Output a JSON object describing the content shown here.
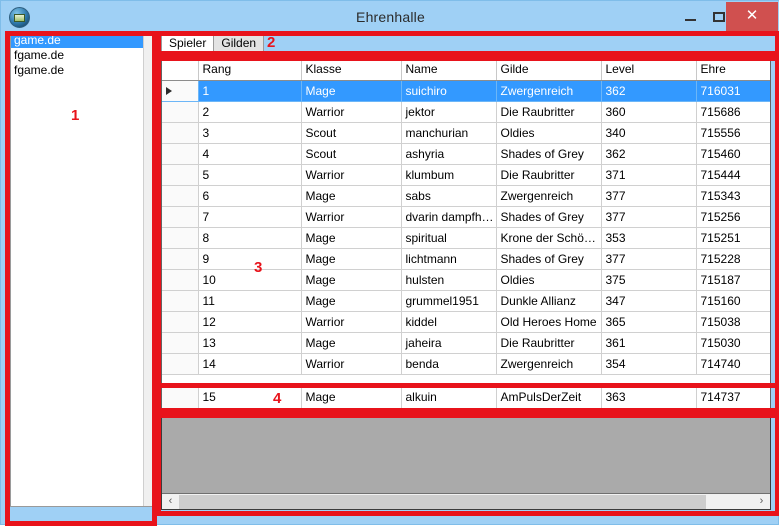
{
  "window": {
    "title": "Ehrenhalle",
    "icon": "app-globe-icon",
    "controls": {
      "minimize": "–",
      "maximize": "☐",
      "close": "✕"
    }
  },
  "sidebar": {
    "items": [
      {
        "label": "game.de",
        "selected": true
      },
      {
        "label": "fgame.de",
        "selected": false
      },
      {
        "label": "fgame.de",
        "selected": false
      }
    ]
  },
  "tabs": [
    {
      "label": "Spieler",
      "active": true
    },
    {
      "label": "Gilden",
      "active": false
    }
  ],
  "grid": {
    "columns": [
      "Rang",
      "Klasse",
      "Name",
      "Gilde",
      "Level",
      "Ehre"
    ],
    "rows": [
      {
        "marker": "▶",
        "selected": true,
        "cells": [
          "1",
          "Mage",
          "suichiro",
          "Zwergenreich",
          "362",
          "716031"
        ]
      },
      {
        "marker": "",
        "selected": false,
        "cells": [
          "2",
          "Warrior",
          "jektor",
          "Die Raubritter",
          "360",
          "715686"
        ]
      },
      {
        "marker": "",
        "selected": false,
        "cells": [
          "3",
          "Scout",
          "manchurian",
          "Oldies",
          "340",
          "715556"
        ]
      },
      {
        "marker": "",
        "selected": false,
        "cells": [
          "4",
          "Scout",
          "ashyria",
          "Shades of Grey",
          "362",
          "715460"
        ]
      },
      {
        "marker": "",
        "selected": false,
        "cells": [
          "5",
          "Warrior",
          "klumbum",
          "Die Raubritter",
          "371",
          "715444"
        ]
      },
      {
        "marker": "",
        "selected": false,
        "cells": [
          "6",
          "Mage",
          "sabs",
          "Zwergenreich",
          "377",
          "715343"
        ]
      },
      {
        "marker": "",
        "selected": false,
        "cells": [
          "7",
          "Warrior",
          "dvarin dampfham...",
          "Shades of Grey",
          "377",
          "715256"
        ]
      },
      {
        "marker": "",
        "selected": false,
        "cells": [
          "8",
          "Mage",
          "spiritual",
          "Krone der Schöpf...",
          "353",
          "715251"
        ]
      },
      {
        "marker": "",
        "selected": false,
        "cells": [
          "9",
          "Mage",
          "lichtmann",
          "Shades of Grey",
          "377",
          "715228"
        ]
      },
      {
        "marker": "",
        "selected": false,
        "cells": [
          "10",
          "Mage",
          "hulsten",
          "Oldies",
          "375",
          "715187"
        ]
      },
      {
        "marker": "",
        "selected": false,
        "cells": [
          "11",
          "Mage",
          "grummel1951",
          "Dunkle Allianz",
          "347",
          "715160"
        ]
      },
      {
        "marker": "",
        "selected": false,
        "cells": [
          "12",
          "Warrior",
          "kiddel",
          "Old Heroes Home",
          "365",
          "715038"
        ]
      },
      {
        "marker": "",
        "selected": false,
        "cells": [
          "13",
          "Mage",
          "jaheira",
          "Die Raubritter",
          "361",
          "715030"
        ]
      },
      {
        "marker": "",
        "selected": false,
        "cells": [
          "14",
          "Warrior",
          "benda",
          "Zwergenreich",
          "354",
          "714740"
        ]
      }
    ],
    "last_row": {
      "marker": "",
      "selected": false,
      "cells": [
        "15",
        "Mage",
        "alkuin",
        "AmPulsDerZeit",
        "363",
        "714737"
      ]
    }
  },
  "bottom_panel": {
    "hscrollbar": {
      "left_arrow": "‹",
      "right_arrow": "›"
    }
  },
  "annotations": [
    {
      "number": "1"
    },
    {
      "number": "2"
    },
    {
      "number": "3"
    },
    {
      "number": "4"
    }
  ],
  "colors": {
    "titlebar": "#9fd0f5",
    "selection": "#3399ff",
    "close_button": "#d0504f",
    "annotation_red": "#e8131b",
    "panel_gray": "#aaaaaa"
  }
}
